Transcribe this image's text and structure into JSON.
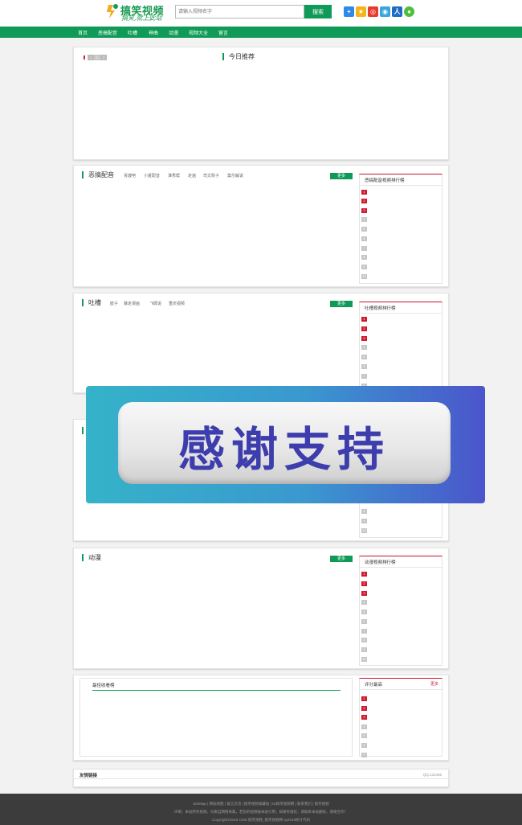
{
  "header": {
    "logo_title": "搞笑视频",
    "logo_slogan": "搞笑,就上此站",
    "search_placeholder": "请输入视频名字",
    "search_button": "搜索"
  },
  "share_icons": [
    "plus-share",
    "star-share",
    "weibo",
    "tencent-weibo",
    "renren",
    "wechat"
  ],
  "nav": [
    "首页",
    "恶搞配音",
    "吐槽",
    "神曲",
    "动漫",
    "视频大全",
    "留言"
  ],
  "today": {
    "title": "今日推荐",
    "slider_dots": [
      "1",
      "2",
      "3",
      "4"
    ]
  },
  "sections": [
    {
      "title": "恶搞配音",
      "links": [
        "胥渡吧",
        "小夏配音",
        "淮秀帮",
        "走遍",
        "司文败子",
        "莫尔解说"
      ],
      "more": "更多",
      "rank_title": "恶搞配音视频排行榜",
      "rank_nums": [
        "1",
        "2",
        "3",
        "4",
        "5",
        "6",
        "7",
        "8",
        "9",
        "10"
      ]
    },
    {
      "title": "吐槽",
      "links": [
        "欧子",
        "暴走漫画",
        "飞碟说",
        "重庆视频"
      ],
      "more": "更多",
      "rank_title": "吐槽视频排行榜",
      "rank_nums": [
        "1",
        "2",
        "3",
        "4",
        "5",
        "6",
        "7",
        "8"
      ]
    },
    {
      "rank_nums": [
        "8",
        "9",
        "10"
      ]
    },
    {
      "title": "动漫",
      "links": [],
      "more": "更多",
      "rank_title": "动漫视频排行榜",
      "rank_nums": [
        "1",
        "2",
        "3",
        "4",
        "5",
        "6",
        "7",
        "8",
        "9",
        "10"
      ]
    }
  ],
  "fav": {
    "title": "最佳收看榜",
    "score_title": "评分最高",
    "more": "更多",
    "rank_nums": [
      "1",
      "2",
      "3",
      "4",
      "5",
      "6",
      "7"
    ]
  },
  "friends": {
    "title": "友情链接",
    "qq": "QQ:123456"
  },
  "overlay": {
    "text": "感谢支持"
  },
  "footer": {
    "line1": "SiteMap | 网站地图 | 留言交流 | 搞笑视频收藏站 | txt搞笑视频网 | 联系我们 | 搞笑视频",
    "line2": "声明：本站所有视频，均来自网络采集，若您的视频被本站引用，如果有侵权，请联系本站删除，谢谢合作！",
    "line3": "Copyright©2016 CMS 搞笑视频_搞笑视频网 sp2019统计代码"
  }
}
